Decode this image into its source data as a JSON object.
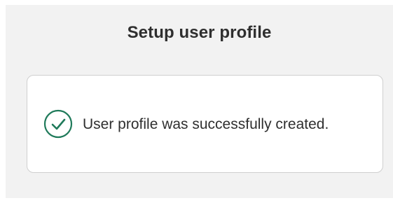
{
  "dialog": {
    "title": "Setup user profile",
    "message": "User profile was successfully created.",
    "status_icon": "check-circle-icon",
    "status_color": "#1f7a5a"
  }
}
